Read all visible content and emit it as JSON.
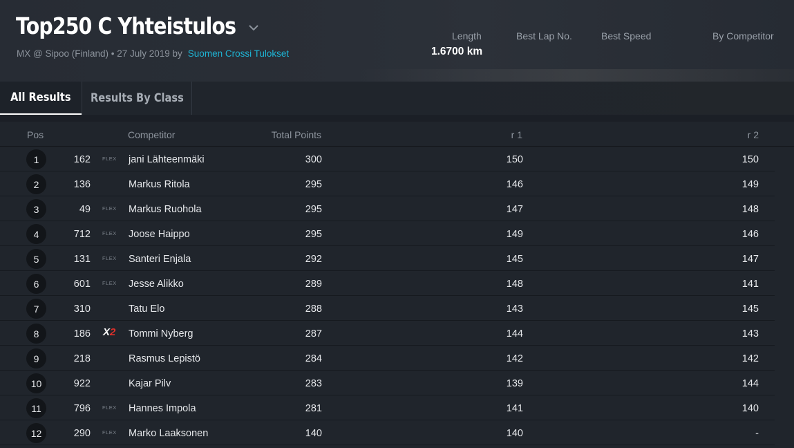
{
  "header": {
    "title": "Top250 C Yhteistulos",
    "subtitle_prefix": "MX @ Sipoo (Finland) • 27 July 2019 by",
    "organizer_link": "Suomen Crossi Tulokset",
    "stats": [
      {
        "label": "Length",
        "value": "1.6700 km"
      },
      {
        "label": "Best Lap No.",
        "value": ""
      },
      {
        "label": "Best Speed",
        "value": ""
      },
      {
        "label": "By Competitor",
        "value": ""
      }
    ]
  },
  "tabs": [
    {
      "label": "All Results",
      "active": true
    },
    {
      "label": "Results By Class",
      "active": false
    }
  ],
  "table": {
    "columns": {
      "pos": "Pos",
      "competitor": "Competitor",
      "total": "Total Points",
      "r1": "r 1",
      "r2": "r 2"
    },
    "rows": [
      {
        "pos": "1",
        "number": "162",
        "badge": "FLEX",
        "name": "jani Lähteenmäki",
        "total": "300",
        "r1": "150",
        "r2": "150"
      },
      {
        "pos": "2",
        "number": "136",
        "badge": "",
        "name": "Markus Ritola",
        "total": "295",
        "r1": "146",
        "r2": "149"
      },
      {
        "pos": "3",
        "number": "49",
        "badge": "FLEX",
        "name": "Markus Ruohola",
        "total": "295",
        "r1": "147",
        "r2": "148"
      },
      {
        "pos": "4",
        "number": "712",
        "badge": "FLEX",
        "name": "Joose Haippo",
        "total": "295",
        "r1": "149",
        "r2": "146"
      },
      {
        "pos": "5",
        "number": "131",
        "badge": "FLEX",
        "name": "Santeri Enjala",
        "total": "292",
        "r1": "145",
        "r2": "147"
      },
      {
        "pos": "6",
        "number": "601",
        "badge": "FLEX",
        "name": "Jesse Alikko",
        "total": "289",
        "r1": "148",
        "r2": "141"
      },
      {
        "pos": "7",
        "number": "310",
        "badge": "",
        "name": "Tatu Elo",
        "total": "288",
        "r1": "143",
        "r2": "145"
      },
      {
        "pos": "8",
        "number": "186",
        "badge": "X2",
        "name": "Tommi Nyberg",
        "total": "287",
        "r1": "144",
        "r2": "143"
      },
      {
        "pos": "9",
        "number": "218",
        "badge": "",
        "name": "Rasmus Lepistö",
        "total": "284",
        "r1": "142",
        "r2": "142"
      },
      {
        "pos": "10",
        "number": "922",
        "badge": "",
        "name": "Kajar Pilv",
        "total": "283",
        "r1": "139",
        "r2": "144"
      },
      {
        "pos": "11",
        "number": "796",
        "badge": "FLEX",
        "name": "Hannes Impola",
        "total": "281",
        "r1": "141",
        "r2": "140"
      },
      {
        "pos": "12",
        "number": "290",
        "badge": "FLEX",
        "name": "Marko Laaksonen",
        "total": "140",
        "r1": "140",
        "r2": "-"
      }
    ]
  },
  "colors": {
    "link": "#1eb4d4",
    "x2_accent": "#e0312b",
    "background": "#20252c"
  }
}
